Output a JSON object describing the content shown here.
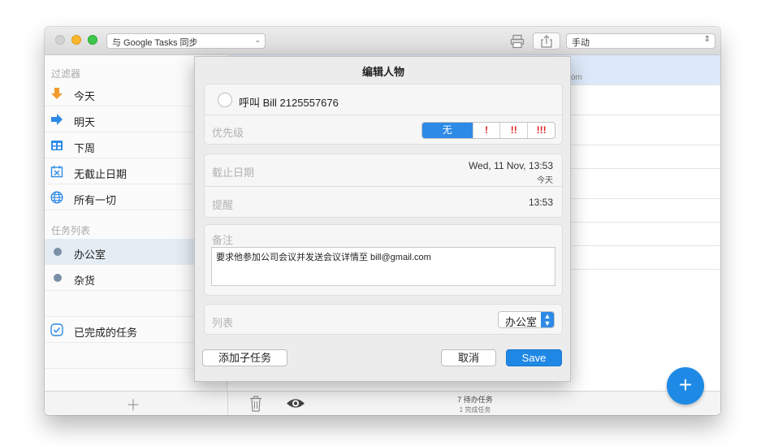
{
  "window": {
    "sync_dropdown": "与 Google Tasks 同步",
    "sort_dropdown": "手动"
  },
  "sidebar": {
    "filters_header": "过滤器",
    "filters": [
      {
        "label": "今天",
        "icon": "arrow-down-icon"
      },
      {
        "label": "明天",
        "icon": "arrow-right-icon"
      },
      {
        "label": "下周",
        "icon": "calendar-week-icon"
      },
      {
        "label": "无截止日期",
        "icon": "calendar-x-icon"
      },
      {
        "label": "所有一切",
        "icon": "globe-icon"
      }
    ],
    "lists_header": "任务列表",
    "lists": [
      {
        "label": "办公室",
        "color": "#7b8fa6"
      },
      {
        "label": "杂货",
        "color": "#7b8fa6"
      }
    ],
    "completed": {
      "label": "已完成的任务",
      "icon": "checkmark-circle-icon"
    }
  },
  "main": {
    "peek_text": "om"
  },
  "bottom_bar": {
    "pending_count": "7 待办任务",
    "completed_count": "1 完成任务"
  },
  "dialog": {
    "title": "编辑人物",
    "task_title": "呼叫 Bill 2125557676",
    "priority": {
      "label": "优先级",
      "options": [
        "无",
        "!",
        "!!",
        "!!!"
      ],
      "selected": "无"
    },
    "due_date": {
      "label": "截止日期",
      "value": "Wed, 11 Nov, 13:53",
      "relative": "今天"
    },
    "reminder": {
      "label": "提醒",
      "value": "13:53"
    },
    "notes": {
      "label": "备注",
      "value": "要求他参加公司会议并发送会议详情至 bill@gmail.com"
    },
    "list": {
      "label": "列表",
      "value": "办公室"
    },
    "buttons": {
      "add_subtask": "添加子任务",
      "cancel": "取消",
      "save": "Save"
    }
  },
  "colors": {
    "accent": "#1f88e5",
    "priority_red": "#e0201c",
    "fab": "#1e8ae6"
  }
}
